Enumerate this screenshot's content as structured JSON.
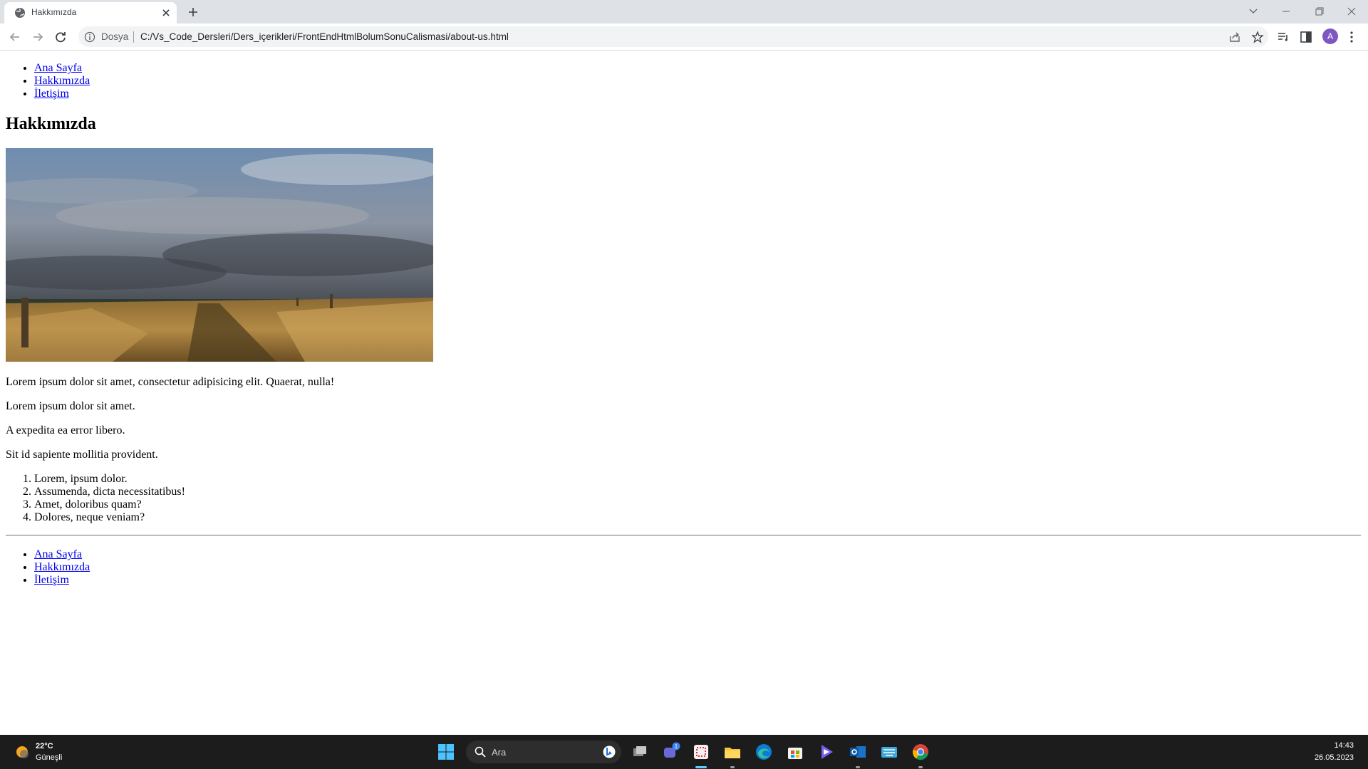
{
  "browser": {
    "tab_title": "Hakkımızda",
    "omnibox_scheme": "Dosya",
    "url": "C:/Vs_Code_Dersleri/Ders_içerikleri/FrontEndHtmlBolumSonuCalismasi/about-us.html",
    "profile_initial": "A",
    "profile_color": "#7e57c2"
  },
  "page": {
    "nav_top": [
      "Ana Sayfa",
      "Hakkımızda",
      "İletişim"
    ],
    "title": "Hakkımızda",
    "paragraphs": [
      "Lorem ipsum dolor sit amet, consectetur adipisicing elit. Quaerat, nulla!",
      "Lorem ipsum dolor sit amet.",
      "A expedita ea error libero.",
      "Sit id sapiente mollitia provident."
    ],
    "ordered_list": [
      "Lorem, ipsum dolor.",
      "Assumenda, dicta necessitatibus!",
      "Amet, doloribus quam?",
      "Dolores, neque veniam?"
    ],
    "nav_bottom": [
      "Ana Sayfa",
      "Hakkımızda",
      "İletişim"
    ],
    "link_color": "#0000ee"
  },
  "taskbar": {
    "weather_temp": "22°C",
    "weather_condition": "Güneşli",
    "search_placeholder": "Ara",
    "teams_badge": "1",
    "time": "14:43",
    "date": "26.05.2023"
  }
}
